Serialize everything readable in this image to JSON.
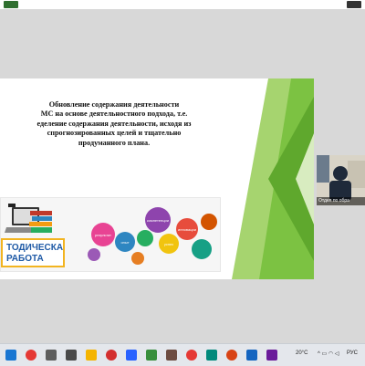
{
  "slide": {
    "title_lines": [
      "Обновление содержания деятельности",
      "МС на основе деятельностного подхода, т.е.",
      "еделение содержания деятельности, исходя из",
      "спрогнозированных целей и тщательно",
      "продуманного плана."
    ],
    "banner_label_line1": "ТОДИЧЕСКАЯ",
    "banner_label_line2": "РАБОТА",
    "bubble_words": [
      "компетенции",
      "инновации",
      "результат",
      "опыт",
      "успех"
    ]
  },
  "participant": {
    "name": "Отдел по обра"
  },
  "taskbar": {
    "weather": "20°C",
    "language": "РУС"
  },
  "colors": {
    "slide_green": "#7cc242",
    "banner_blue": "#1f5aa6",
    "banner_border": "#f2b420"
  }
}
